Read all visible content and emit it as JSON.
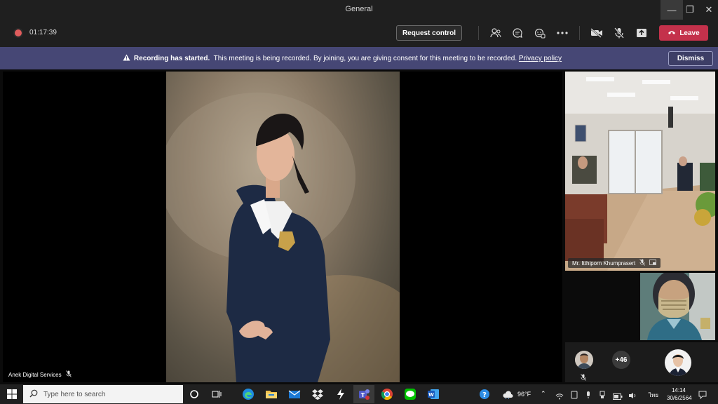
{
  "window": {
    "title": "General"
  },
  "toolbar": {
    "recording_time": "01:17:39",
    "request_control_label": "Request control",
    "leave_label": "Leave"
  },
  "banner": {
    "bold_text": "Recording has started.",
    "message": "This meeting is being recorded. By joining, you are giving consent for this meeting to be recorded.",
    "link_text": "Privacy policy",
    "dismiss_label": "Dismiss"
  },
  "main_video": {
    "participant_name": "Anek Digital Services"
  },
  "side_video": {
    "participant_name": "Mr. Itthiporn Khumprasert"
  },
  "gallery": {
    "more_count": "+46"
  },
  "taskbar": {
    "search_placeholder": "Type here to search",
    "weather_temp": "96°F",
    "ime_label": "ไทย",
    "time": "14:14",
    "date": "30/6/2564"
  },
  "colors": {
    "banner_bg": "#464775",
    "leave_button": "#c4314b",
    "recording_dot": "#e05c5c",
    "titlebar_bg": "#1f1f1f",
    "taskbar_bg": "#202020"
  },
  "icons": [
    "record-icon",
    "people-icon",
    "chat-icon",
    "reactions-icon",
    "more-icon",
    "camera-off-icon",
    "mic-off-icon",
    "share-icon",
    "phone-icon",
    "warning-icon",
    "windows-start-icon",
    "search-icon",
    "task-view-icon",
    "cortana-icon",
    "edge-icon",
    "file-explorer-icon",
    "mail-icon",
    "dropbox-icon",
    "teams-icon",
    "chrome-icon",
    "line-icon",
    "word-icon",
    "help-icon",
    "weather-icon",
    "notification-icon"
  ]
}
